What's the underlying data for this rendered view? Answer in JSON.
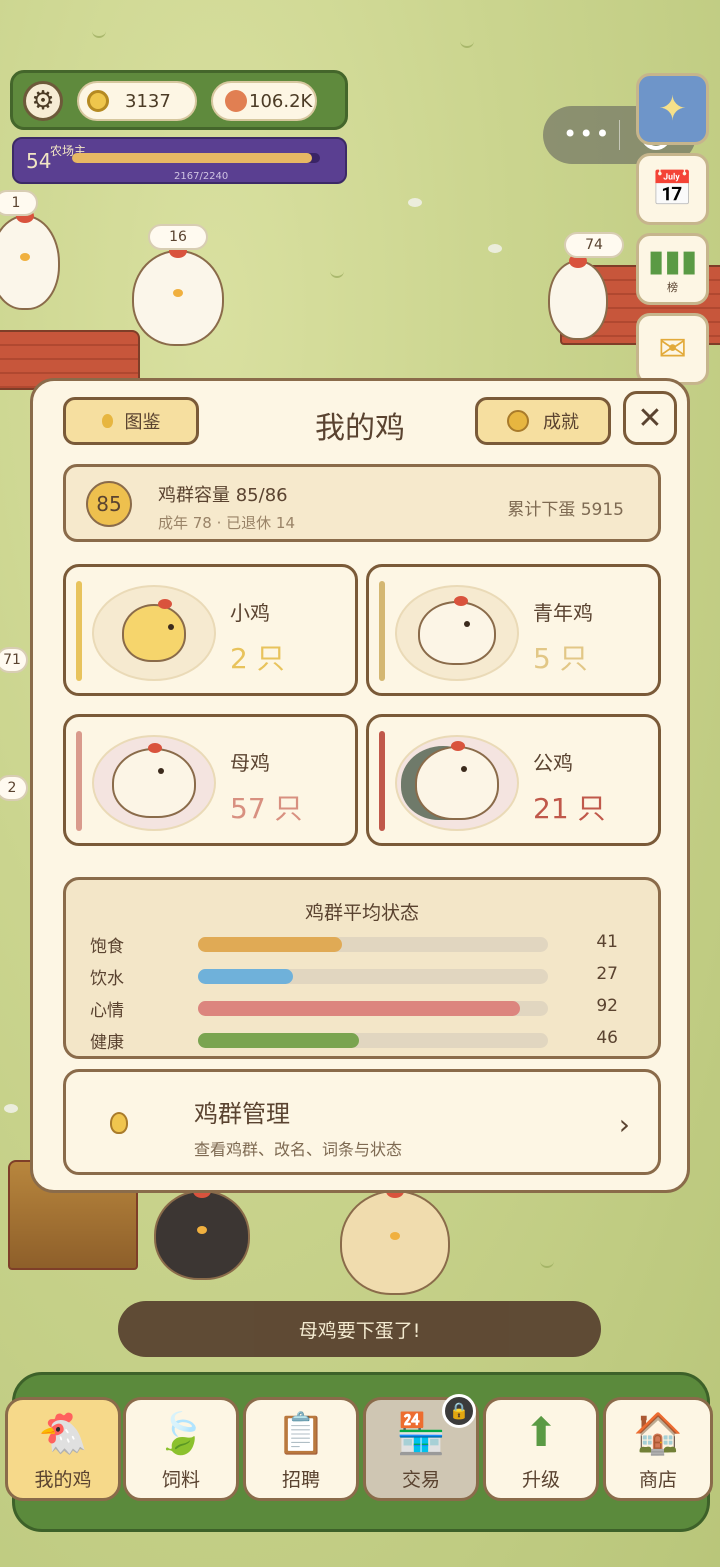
{
  "hud": {
    "coins": "3137",
    "gems": "106.2K",
    "level": "54",
    "level_title": "农场主",
    "xp_text": "2167/2240",
    "xp_fraction": 0.967
  },
  "world_tags": [
    "1",
    "16",
    "74",
    "71",
    "2"
  ],
  "side_buttons": [
    {
      "name": "globe-button",
      "icon": "globe-icon"
    },
    {
      "name": "calendar-checkin-button",
      "icon": "calendar-check-icon"
    },
    {
      "name": "leaderboard-button",
      "icon": "bar-chart-icon",
      "label": "榜"
    },
    {
      "name": "mail-button",
      "icon": "envelope-icon"
    }
  ],
  "modal": {
    "title": "我的鸡",
    "left_button": "图鉴",
    "right_button": "成就",
    "capacity": {
      "badge": "85",
      "line1": "鸡群容量 85/86",
      "line2": "成年 78 · 已退休 14",
      "total_eggs": "累计下蛋 5915"
    },
    "categories": [
      {
        "name": "小鸡",
        "count": "2 只",
        "stripe": "#e8c35c",
        "count_color": "#e8c35c"
      },
      {
        "name": "青年鸡",
        "count": "5 只",
        "stripe": "#d4b772",
        "count_color": "#e2c786"
      },
      {
        "name": "母鸡",
        "count": "57 只",
        "stripe": "#d99a8c",
        "count_color": "#d89080"
      },
      {
        "name": "公鸡",
        "count": "21 只",
        "stripe": "#c0584a",
        "count_color": "#c0584a"
      }
    ],
    "stats": {
      "heading": "鸡群平均状态",
      "rows": [
        {
          "label": "饱食",
          "value": "41",
          "pct": 41,
          "color": "#e0aa55"
        },
        {
          "label": "饮水",
          "value": "27",
          "pct": 27,
          "color": "#6fb1da"
        },
        {
          "label": "心情",
          "value": "92",
          "pct": 92,
          "color": "#dc857e"
        },
        {
          "label": "健康",
          "value": "46",
          "pct": 46,
          "color": "#7aa450"
        }
      ]
    },
    "management": {
      "title": "鸡群管理",
      "subtitle": "查看鸡群、改名、词条与状态",
      "arrow": "›"
    }
  },
  "toast": "母鸡要下蛋了!",
  "tabs": [
    {
      "label": "我的鸡",
      "glyph": "🐔",
      "state": "selected"
    },
    {
      "label": "饲料",
      "glyph": "🍃",
      "state": "normal"
    },
    {
      "label": "招聘",
      "glyph": "📋",
      "state": "normal"
    },
    {
      "label": "交易",
      "glyph": "🏪",
      "state": "locked"
    },
    {
      "label": "升级",
      "glyph": "⬆",
      "state": "normal"
    },
    {
      "label": "商店",
      "glyph": "🏠",
      "state": "normal"
    }
  ]
}
